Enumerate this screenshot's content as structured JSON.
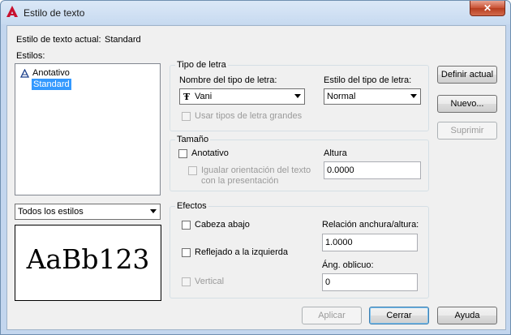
{
  "window": {
    "title": "Estilo de texto",
    "close_glyph": "✕"
  },
  "current_style": {
    "label": "Estilo de texto actual:",
    "value": "Standard"
  },
  "styles": {
    "label": "Estilos:",
    "items": [
      {
        "label": "Anotativo",
        "icon": "annotative-icon"
      },
      {
        "label": "Standard",
        "selected": true
      }
    ],
    "filter_value": "Todos los estilos"
  },
  "preview": {
    "sample_text": "AaBb123"
  },
  "font": {
    "group_title": "Tipo de letra",
    "font_name_label": "Nombre del tipo de letra:",
    "font_name_value": "Vani",
    "font_style_label": "Estilo del tipo de letra:",
    "font_style_value": "Normal",
    "bigfont_label": "Usar tipos de letra grandes"
  },
  "size": {
    "group_title": "Tamaño",
    "annotative_label": "Anotativo",
    "match_orientation_label_line1": "Igualar orientación del texto",
    "match_orientation_label_line2": "con la presentación",
    "height_label": "Altura",
    "height_value": "0.0000"
  },
  "effects": {
    "group_title": "Efectos",
    "upside_down_label": "Cabeza abajo",
    "backwards_label": "Reflejado a la izquierda",
    "vertical_label": "Vertical",
    "width_factor_label": "Relación anchura/altura:",
    "width_factor_value": "1.0000",
    "oblique_label": "Áng. oblicuo:",
    "oblique_value": "0"
  },
  "buttons": {
    "set_current": "Definir actual",
    "new": "Nuevo...",
    "delete": "Suprimir",
    "apply": "Aplicar",
    "close": "Cerrar",
    "help": "Ayuda"
  },
  "colors": {
    "selection": "#3399ff",
    "close_button": "#c85032",
    "app_icon": "#c8102e"
  }
}
